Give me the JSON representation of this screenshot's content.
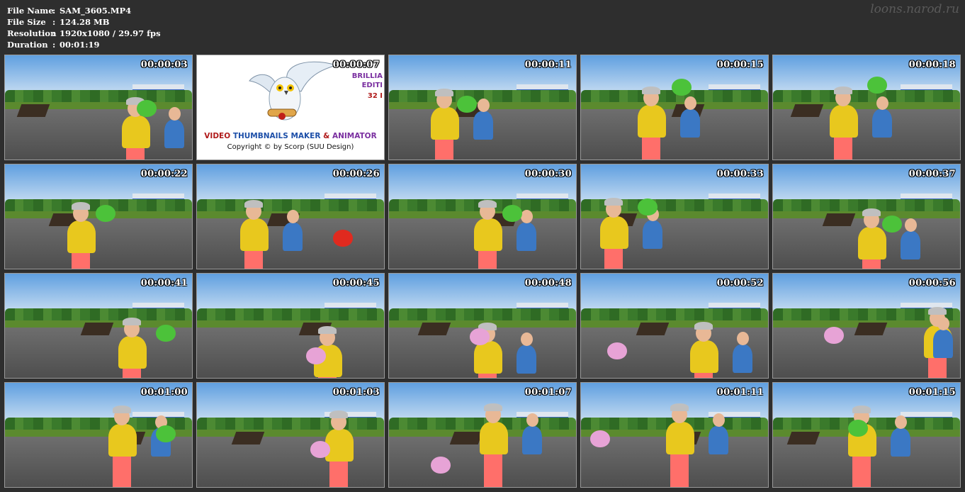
{
  "file_info": {
    "rows": [
      {
        "label": "File Name",
        "sep": ":",
        "value": "SAM_3605.MP4"
      },
      {
        "label": "File Size",
        "sep": ":",
        "value": "124.28 MB"
      },
      {
        "label": "Resolution",
        "sep": ":",
        "value": "1920x1080 / 29.97 fps"
      },
      {
        "label": "Duration",
        "sep": ":",
        "value": "00:01:19"
      }
    ]
  },
  "watermark": "loons.narod.ru",
  "logo_card": {
    "title_words": [
      "VIDEO",
      "THUMBNAILS MAKER",
      "&",
      "ANIMATOR"
    ],
    "copyright": "Copyright © by Scorp (SUU Design)",
    "side_lines": [
      "BRILLIA",
      "EDITI",
      "32 I"
    ],
    "timestamp": "00:00:07"
  },
  "thumbnails": [
    {
      "time": "00:00:03"
    },
    {
      "time": "00:00:07",
      "is_logo": true
    },
    {
      "time": "00:00:11"
    },
    {
      "time": "00:00:15"
    },
    {
      "time": "00:00:18"
    },
    {
      "time": "00:00:22"
    },
    {
      "time": "00:00:26"
    },
    {
      "time": "00:00:30"
    },
    {
      "time": "00:00:33"
    },
    {
      "time": "00:00:37"
    },
    {
      "time": "00:00:41"
    },
    {
      "time": "00:00:45"
    },
    {
      "time": "00:00:48"
    },
    {
      "time": "00:00:52"
    },
    {
      "time": "00:00:56"
    },
    {
      "time": "00:01:00"
    },
    {
      "time": "00:01:03"
    },
    {
      "time": "00:01:07"
    },
    {
      "time": "00:01:11"
    },
    {
      "time": "00:01:15"
    }
  ],
  "colors": {
    "background": "#2e2e2e",
    "shirt_yellow": "#e8c81e",
    "jacket_blue": "#3b78c4",
    "pants_pink": "#ff6f6a",
    "balloon_green": "#4cc23a",
    "balloon_red": "#e02a1f",
    "balloon_pink": "#e7a3d6"
  }
}
